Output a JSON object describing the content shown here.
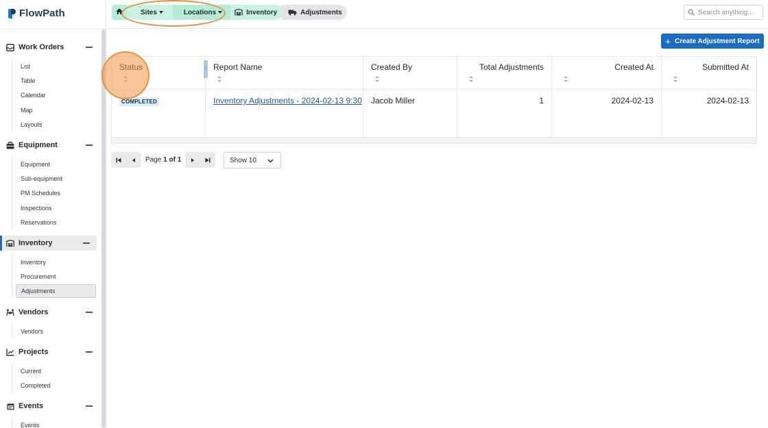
{
  "app": {
    "name": "FlowPath"
  },
  "sidebar": {
    "sections": [
      {
        "label": "Work Orders",
        "icon": "inbox-icon",
        "items": [
          "List",
          "Table",
          "Calendar",
          "Map",
          "Layouts"
        ]
      },
      {
        "label": "Equipment",
        "icon": "toolbox-icon",
        "items": [
          "Equipment",
          "Sub-equipment",
          "PM Schedules",
          "Inspections",
          "Reservations"
        ]
      },
      {
        "label": "Inventory",
        "icon": "warehouse-icon",
        "items": [
          "Inventory",
          "Procurement",
          "Adjustments"
        ],
        "active": true,
        "selected_item": "Adjustments"
      },
      {
        "label": "Vendors",
        "icon": "people-carry-icon",
        "items": [
          "Vendors"
        ]
      },
      {
        "label": "Projects",
        "icon": "chart-line-icon",
        "items": [
          "Current",
          "Completed"
        ]
      },
      {
        "label": "Events",
        "icon": "calendar-icon",
        "items": [
          "Events"
        ]
      }
    ]
  },
  "breadcrumbs": {
    "sites": "Sites",
    "locations": "Locations",
    "inventory": "Inventory",
    "adjustments": "Adjustments"
  },
  "search": {
    "placeholder": "Search anything..."
  },
  "toolbar": {
    "create_label": "Create Adjustment Report"
  },
  "table": {
    "columns": [
      "Status",
      "Report Name",
      "Created By",
      "Total Adjustments",
      "Created At",
      "Submitted At"
    ],
    "rows": [
      {
        "status": "COMPLETED",
        "report_name": "Inventory Adjustments - 2024-02-13 9:30",
        "created_by": "Jacob Miller",
        "total_adjustments": "1",
        "created_at": "2024-02-13",
        "submitted_at": "2024-02-13"
      }
    ]
  },
  "pagination": {
    "page_prefix": "Page",
    "current": "1",
    "of": "of",
    "total": "1",
    "show_label": "Show 10"
  },
  "colors": {
    "accent": "#1a6dc2",
    "breadcrumb": "#b5ecd8",
    "highlight": "#e8913a"
  }
}
